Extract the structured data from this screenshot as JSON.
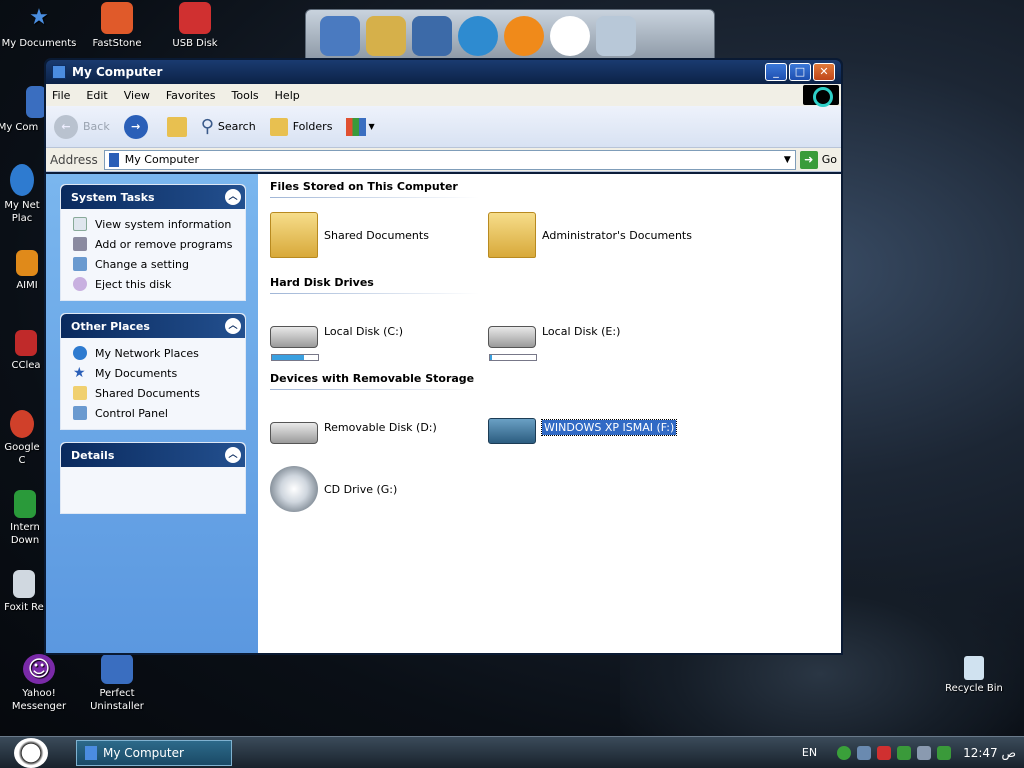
{
  "desktop": {
    "icons": [
      {
        "label": "My Documents"
      },
      {
        "label": "FastStone"
      },
      {
        "label": "USB Disk"
      },
      {
        "label": "My Com"
      },
      {
        "label": "My Net Plac"
      },
      {
        "label": "AIMI"
      },
      {
        "label": "CClea"
      },
      {
        "label": "Google C"
      },
      {
        "label": "Intern Down"
      },
      {
        "label": "Foxit Re"
      },
      {
        "label": "Yahoo! Messenger"
      },
      {
        "label": "Perfect Uninstaller"
      }
    ],
    "recycle_bin": "Recycle Bin"
  },
  "window": {
    "title": "My Computer",
    "controls": {
      "minimize": "_",
      "maximize": "□",
      "close": "✕"
    },
    "menu": [
      "File",
      "Edit",
      "View",
      "Favorites",
      "Tools",
      "Help"
    ],
    "toolbar": {
      "back": "Back",
      "search": "Search",
      "folders": "Folders"
    },
    "address": {
      "label": "Address",
      "value": "My Computer",
      "go": "Go"
    }
  },
  "sidebar": {
    "system_tasks": {
      "title": "System Tasks",
      "items": [
        "View system information",
        "Add or remove programs",
        "Change a setting",
        "Eject this disk"
      ]
    },
    "other_places": {
      "title": "Other Places",
      "items": [
        "My Network Places",
        "My Documents",
        "Shared Documents",
        "Control Panel"
      ]
    },
    "details": {
      "title": "Details"
    }
  },
  "main": {
    "groups": [
      {
        "title": "Files Stored on This Computer",
        "items": [
          "Shared Documents",
          "Administrator's Documents"
        ]
      },
      {
        "title": "Hard Disk Drives",
        "items": [
          "Local Disk (C:)",
          "Local Disk (E:)"
        ]
      },
      {
        "title": "Devices with Removable Storage",
        "items": [
          "Removable Disk (D:)",
          "WINDOWS XP ISMAI (F:)",
          "CD Drive (G:)"
        ]
      }
    ],
    "drive_usage": {
      "c": 0.7,
      "e": 0.05
    }
  },
  "taskbar": {
    "task": "My Computer",
    "lang": "EN",
    "clock": "12:47 ص"
  }
}
